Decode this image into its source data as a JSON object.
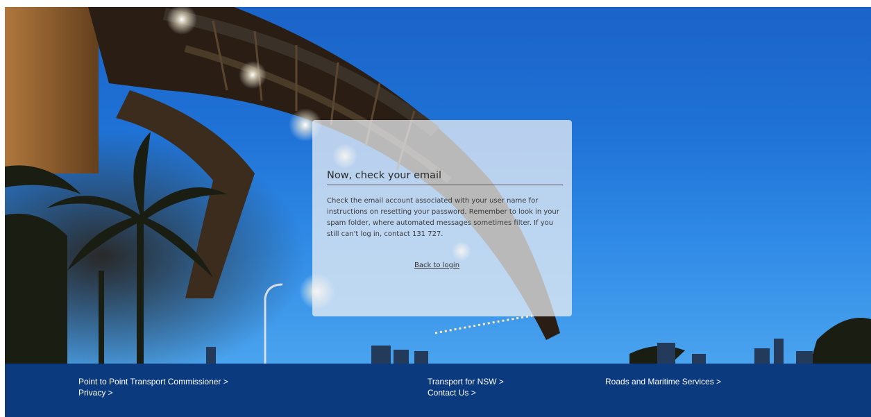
{
  "card": {
    "title": "Now, check your email",
    "body": "Check the email account associated with your user name for instructions on resetting your password. Remember to look in your spam folder, where automated messages sometimes filter. If you still can't log in, contact 131 727.",
    "back_link": "Back to login"
  },
  "footer": {
    "links": [
      "Point to Point Transport Commissioner >",
      "Privacy >",
      "Transport for NSW >",
      "Contact Us >",
      "Roads and Maritime Services >"
    ]
  },
  "colors": {
    "footer_bg": "#0b3a7e",
    "sky": "#1f72d6"
  }
}
